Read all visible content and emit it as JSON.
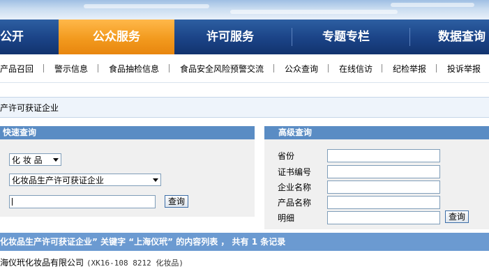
{
  "navbar": {
    "items": [
      {
        "label": "公开"
      },
      {
        "label": "公众服务"
      },
      {
        "label": "许可服务"
      },
      {
        "label": "专题专栏"
      },
      {
        "label": "数据查询"
      }
    ]
  },
  "subnav": {
    "items": [
      {
        "label": "产品召回"
      },
      {
        "label": "警示信息"
      },
      {
        "label": "食品抽检信息"
      },
      {
        "label": "食品安全风险预警交流"
      },
      {
        "label": "公众查询"
      },
      {
        "label": "在线信访"
      },
      {
        "label": "纪检举报"
      },
      {
        "label": "投诉举报"
      }
    ]
  },
  "breadcrumb": {
    "text": "产许可获证企业"
  },
  "quick_search": {
    "title": "快速查询",
    "category_select": "化 妆 品",
    "type_select": "化妆品生产许可获证企业",
    "keyword_value": "",
    "search_button": "查询"
  },
  "advanced_search": {
    "title": "高级查询",
    "fields": [
      {
        "label": "省份",
        "value": ""
      },
      {
        "label": "证书编号",
        "value": ""
      },
      {
        "label": "企业名称",
        "value": ""
      },
      {
        "label": "产品名称",
        "value": ""
      },
      {
        "label": "明细",
        "value": ""
      }
    ],
    "search_button": "查询"
  },
  "results": {
    "header": "化妆品生产许可获证企业” 关键字 “上海仪玳” 的内容列表 ， 共有 1 条记录",
    "rows": [
      {
        "name": "海仪玳化妆品有限公司",
        "detail": "(XK16-108 8212 化妆品)"
      }
    ]
  },
  "colors": {
    "nav_bg": "#1c4589",
    "nav_active": "#f29a1e",
    "panel_header": "#5a8cc4",
    "result_header": "#6b9ad1"
  }
}
